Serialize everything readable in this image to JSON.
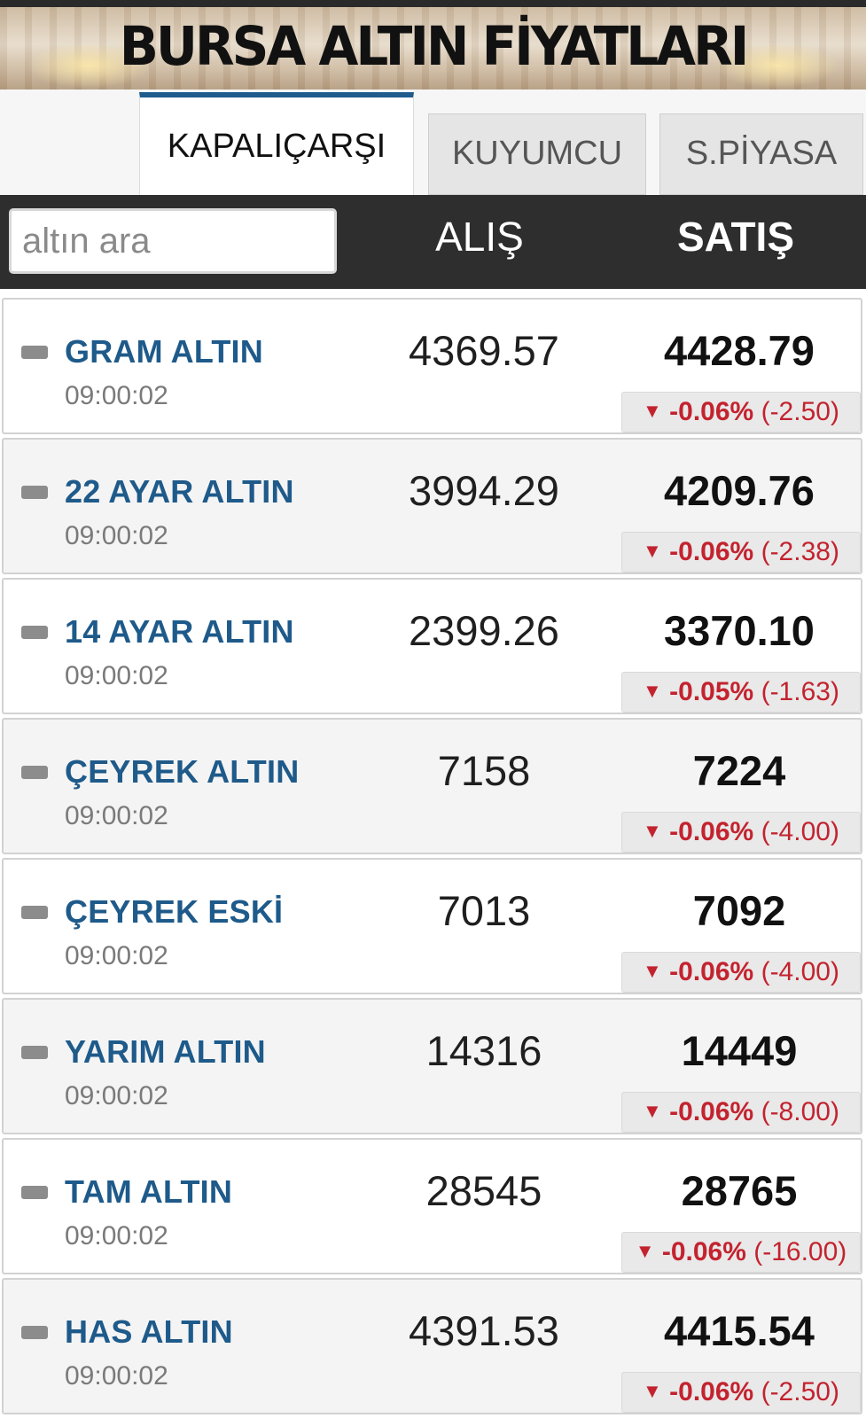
{
  "banner": {
    "title": "BURSA ALTIN FİYATLARI"
  },
  "tabs": [
    {
      "label": "KAPALIÇARŞI",
      "active": true
    },
    {
      "label": "KUYUMCU",
      "active": false
    },
    {
      "label": "S.PİYASA",
      "active": false
    }
  ],
  "search": {
    "placeholder": "altın ara",
    "value": ""
  },
  "columns": {
    "buy": "ALIŞ",
    "sell": "SATIŞ"
  },
  "colors": {
    "name": "#1e5a8a",
    "down": "#c3232f",
    "header_bg": "#2e2e2e",
    "active_tab_accent": "#1f5b8c"
  },
  "items": [
    {
      "name": "GRAM ALTIN",
      "time": "09:00:02",
      "buy": "4369.57",
      "sell": "4428.79",
      "arrow": "▼",
      "pct": "-0.06%",
      "diff": "(-2.50)"
    },
    {
      "name": "22 AYAR ALTIN",
      "time": "09:00:02",
      "buy": "3994.29",
      "sell": "4209.76",
      "arrow": "▼",
      "pct": "-0.06%",
      "diff": "(-2.38)"
    },
    {
      "name": "14 AYAR ALTIN",
      "time": "09:00:02",
      "buy": "2399.26",
      "sell": "3370.10",
      "arrow": "▼",
      "pct": "-0.05%",
      "diff": "(-1.63)"
    },
    {
      "name": "ÇEYREK ALTIN",
      "time": "09:00:02",
      "buy": "7158",
      "sell": "7224",
      "arrow": "▼",
      "pct": "-0.06%",
      "diff": "(-4.00)"
    },
    {
      "name": "ÇEYREK ESKİ",
      "time": "09:00:02",
      "buy": "7013",
      "sell": "7092",
      "arrow": "▼",
      "pct": "-0.06%",
      "diff": "(-4.00)"
    },
    {
      "name": "YARIM ALTIN",
      "time": "09:00:02",
      "buy": "14316",
      "sell": "14449",
      "arrow": "▼",
      "pct": "-0.06%",
      "diff": "(-8.00)"
    },
    {
      "name": "TAM ALTIN",
      "time": "09:00:02",
      "buy": "28545",
      "sell": "28765",
      "arrow": "▼",
      "pct": "-0.06%",
      "diff": "(-16.00)"
    },
    {
      "name": "HAS ALTIN",
      "time": "09:00:02",
      "buy": "4391.53",
      "sell": "4415.54",
      "arrow": "▼",
      "pct": "-0.06%",
      "diff": "(-2.50)"
    }
  ]
}
